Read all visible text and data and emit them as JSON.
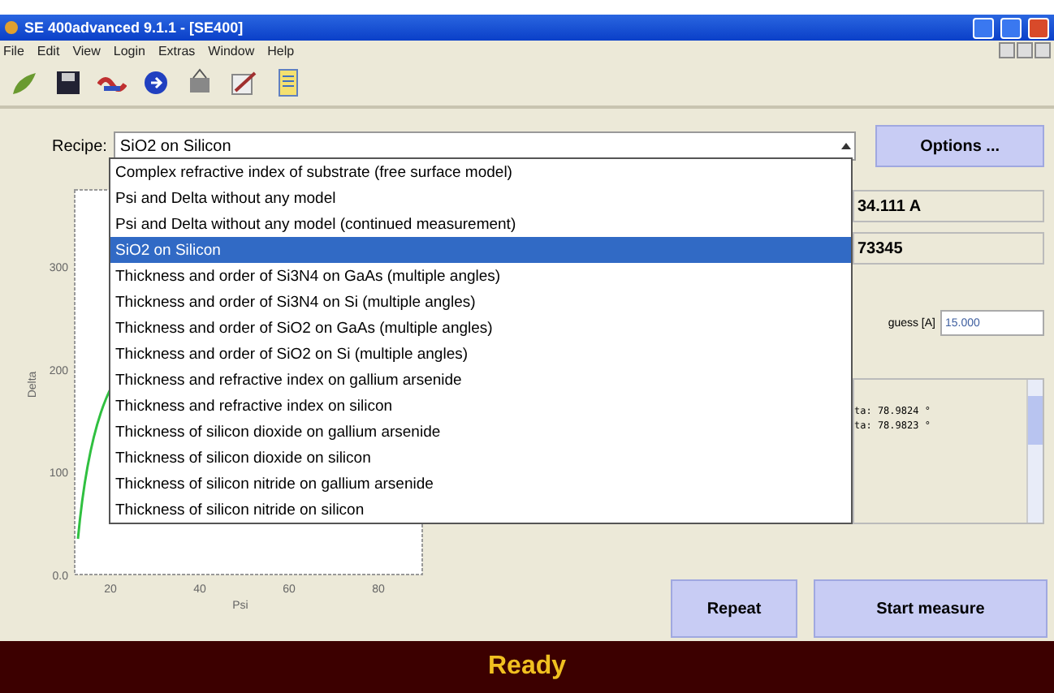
{
  "window": {
    "title": "SE 400advanced 9.1.1 - [SE400]"
  },
  "menu": [
    "File",
    "Edit",
    "View",
    "Login",
    "Extras",
    "Window",
    "Help"
  ],
  "recipe": {
    "label": "Recipe:",
    "value": "SiO2 on Silicon",
    "expanded": true,
    "options": [
      {
        "label": "Complex refractive index of substrate (free surface model)",
        "selected": false
      },
      {
        "label": "Psi and Delta without any model",
        "selected": false
      },
      {
        "label": "Psi and Delta without any model (continued measurement)",
        "selected": false
      },
      {
        "label": "SiO2 on Silicon",
        "selected": true
      },
      {
        "label": "Thickness and order of Si3N4 on GaAs (multiple angles)",
        "selected": false
      },
      {
        "label": "Thickness and order of Si3N4 on Si (multiple angles)",
        "selected": false
      },
      {
        "label": "Thickness and order of SiO2 on GaAs (multiple angles)",
        "selected": false
      },
      {
        "label": "Thickness and order of SiO2 on Si (multiple angles)",
        "selected": false
      },
      {
        "label": "Thickness and refractive index on gallium arsenide",
        "selected": false
      },
      {
        "label": "Thickness and refractive index on silicon",
        "selected": false
      },
      {
        "label": "Thickness of silicon dioxide on gallium arsenide",
        "selected": false
      },
      {
        "label": "Thickness of silicon dioxide on silicon",
        "selected": false
      },
      {
        "label": "Thickness of silicon nitride on gallium arsenide",
        "selected": false
      },
      {
        "label": "Thickness of silicon nitride on silicon",
        "selected": false
      }
    ]
  },
  "options_button": "Options ...",
  "plot": {
    "ylabel": "Delta",
    "xlabel": "Psi",
    "yticks": [
      "300",
      "200",
      "100",
      "0.0"
    ],
    "xticks": [
      "20",
      "40",
      "60",
      "80"
    ]
  },
  "results": {
    "thickness": "34.111 A",
    "index": "73345",
    "guess_label": "guess [A]",
    "guess_value": "15.000"
  },
  "log": [
    "ta: 78.9824 °",
    "ta: 78.9823 °"
  ],
  "buttons": [
    "Repeat",
    "Start measure"
  ],
  "status": "Ready"
}
